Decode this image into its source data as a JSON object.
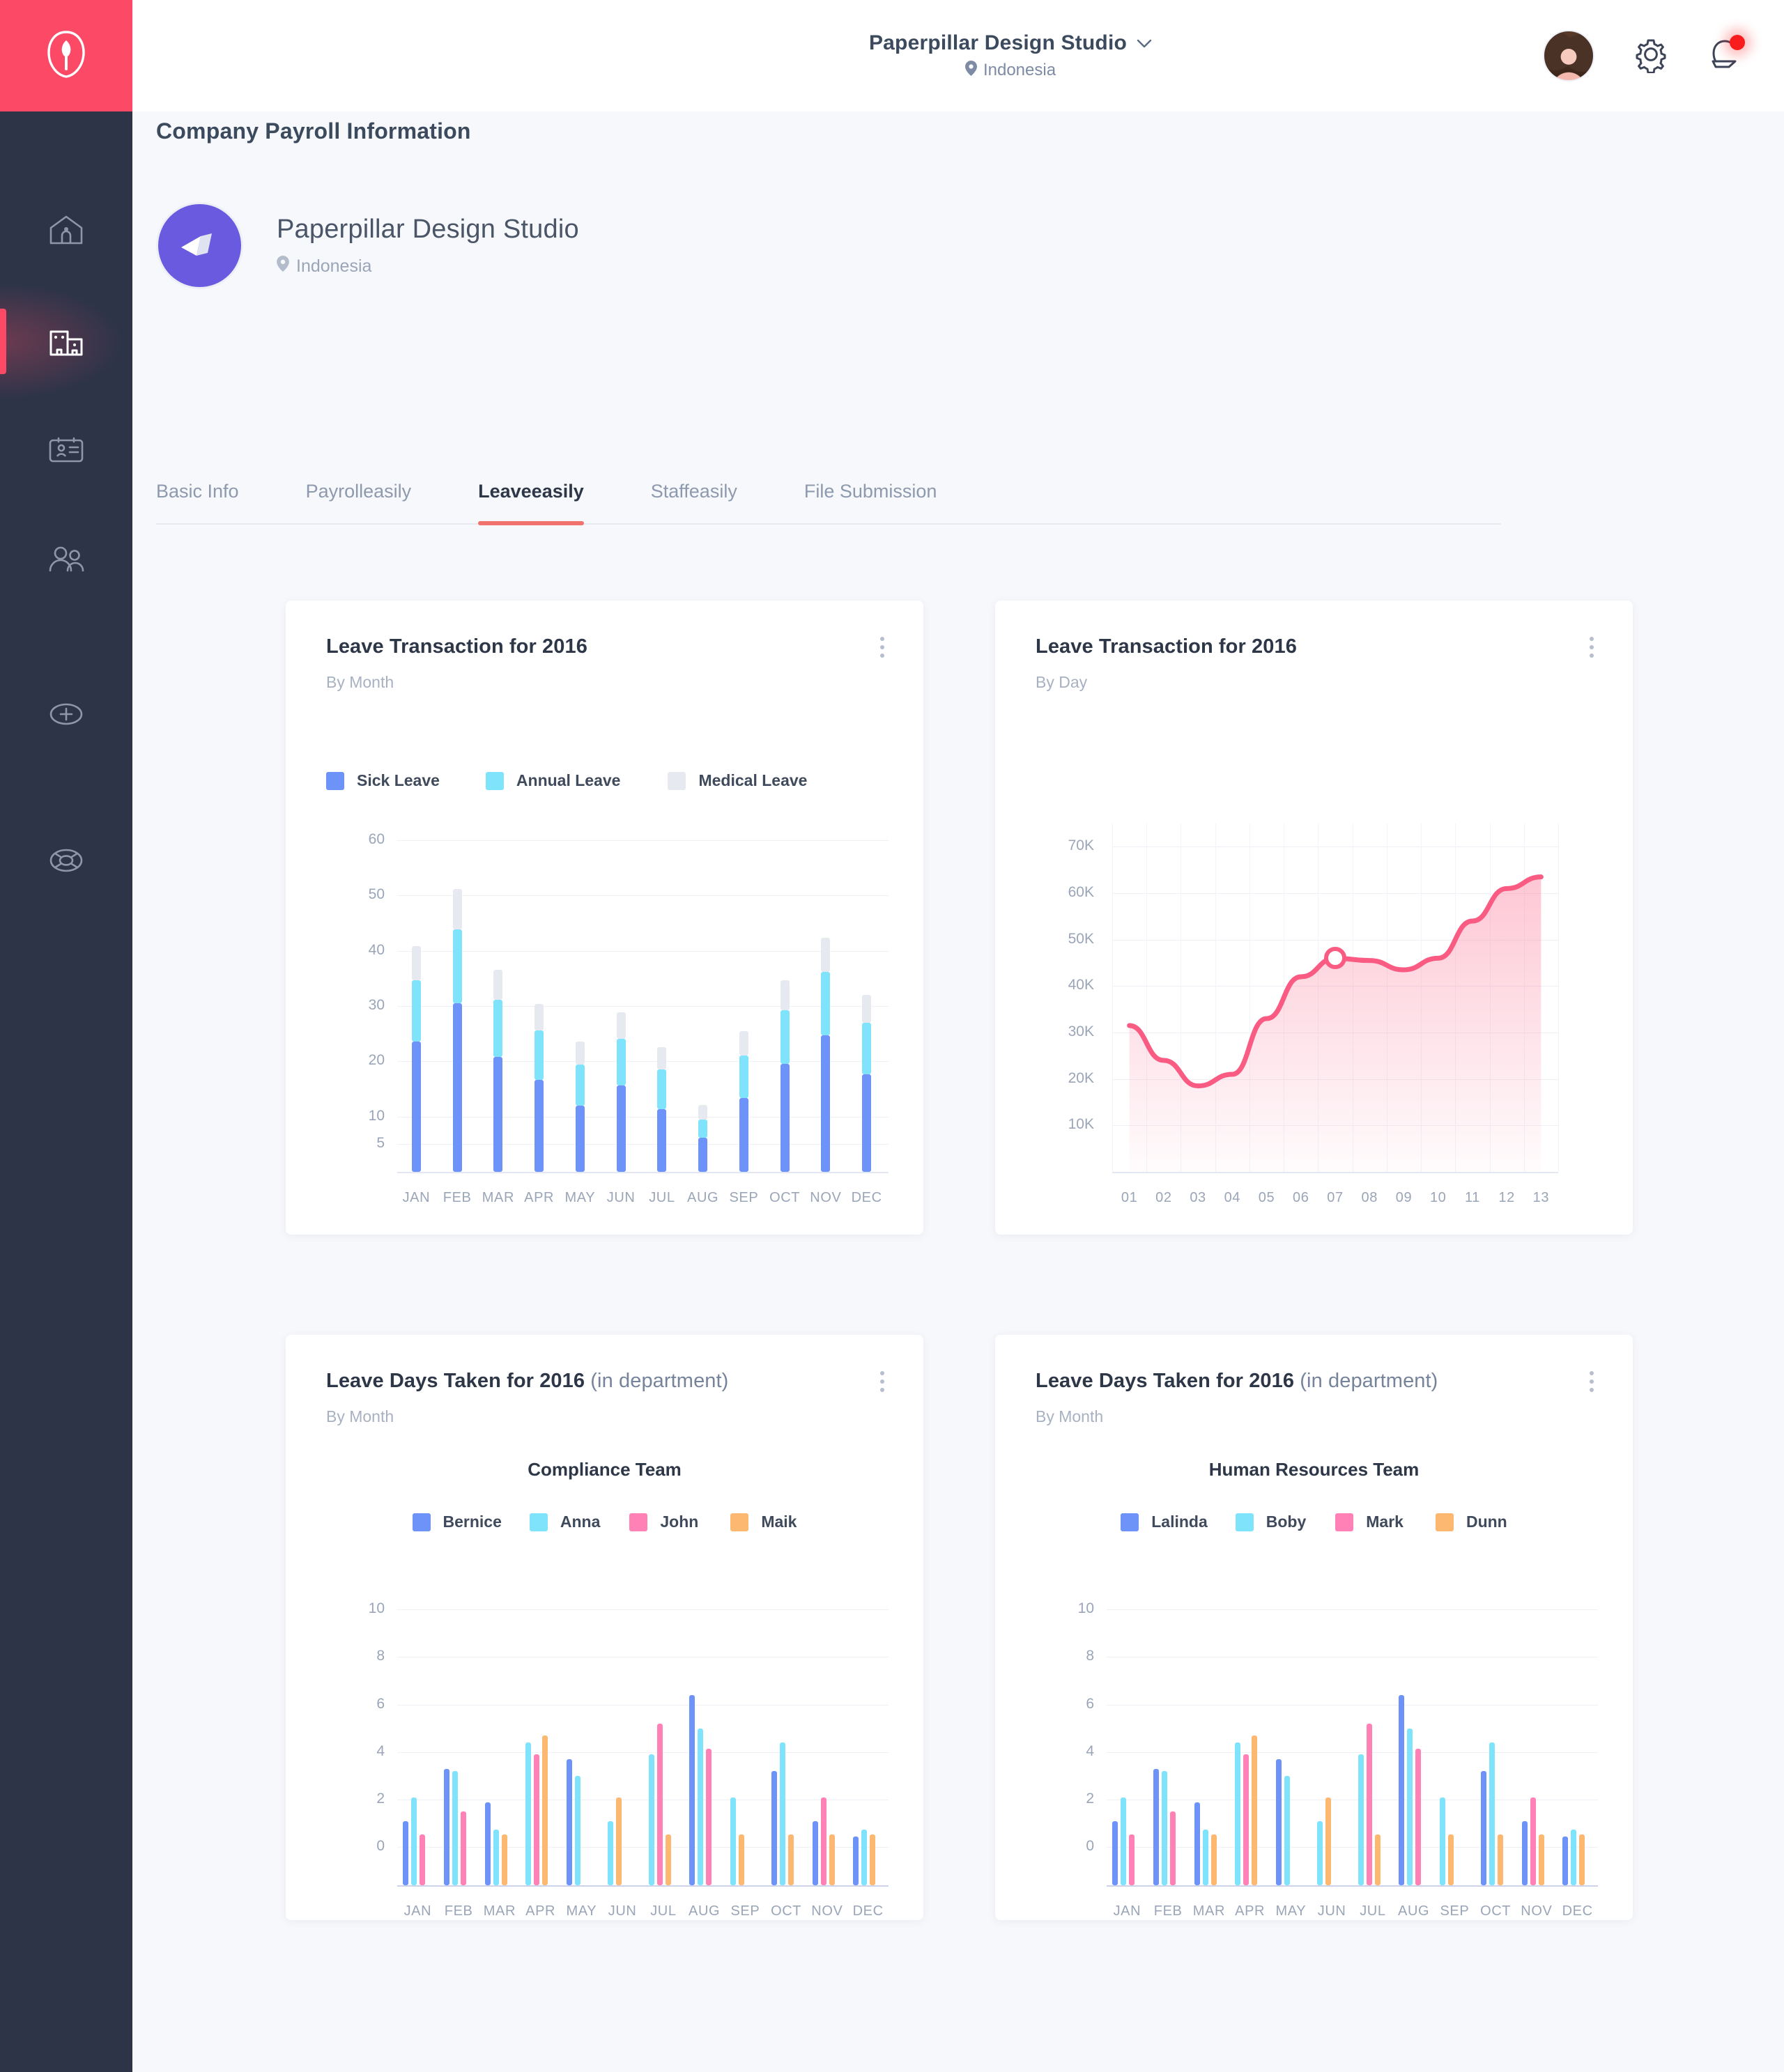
{
  "sidebar": {
    "logo_icon": "leaf-person-logo-icon",
    "items": [
      {
        "icon": "home-icon",
        "name": "home",
        "active": false
      },
      {
        "icon": "buildings-icon",
        "name": "company",
        "active": true
      },
      {
        "icon": "id-card-icon",
        "name": "employee-card",
        "active": false
      },
      {
        "icon": "users-icon",
        "name": "people",
        "active": false
      },
      {
        "icon": "plus-circle-icon",
        "name": "add",
        "active": false
      },
      {
        "icon": "lifebuoy-icon",
        "name": "support",
        "active": false
      }
    ]
  },
  "topbar": {
    "company": "Paperpillar Design Studio",
    "chevron": "˅",
    "location": "Indonesia",
    "avatar_icon": "user-avatar",
    "settings_icon": "gear-icon",
    "notifications_icon": "bell-icon",
    "has_notification": true
  },
  "page": {
    "title": "Company Payroll Information"
  },
  "company": {
    "name": "Paperpillar Design Studio",
    "location": "Indonesia",
    "logo_icon": "paper-plane-logo-icon"
  },
  "tabs": [
    {
      "label": "Basic Info",
      "active": false
    },
    {
      "label": "Payrolleasily",
      "active": false
    },
    {
      "label": "Leaveeasily",
      "active": true
    },
    {
      "label": "Staffeasily",
      "active": false
    },
    {
      "label": "File Submission",
      "active": false
    }
  ],
  "cards": {
    "top_left": {
      "title": "Leave Transaction for 2016",
      "subtitle": "By Month",
      "menu_icon": "kebab-menu-icon"
    },
    "top_right": {
      "title": "Leave Transaction for 2016",
      "subtitle": "By Day",
      "menu_icon": "kebab-menu-icon"
    },
    "bottom_left": {
      "title": "Leave Days Taken for 2016",
      "title_suffix": "(in department)",
      "subtitle": "By Month",
      "team": "Compliance Team",
      "menu_icon": "kebab-menu-icon"
    },
    "bottom_right": {
      "title": "Leave Days Taken for 2016",
      "title_suffix": "(in department)",
      "subtitle": "By Month",
      "team": "Human Resources Team",
      "menu_icon": "kebab-menu-icon"
    }
  },
  "colors": {
    "brand_pink": "#fc4a66",
    "sidebar": "#2e3448",
    "sick_leave": "#6d92f8",
    "annual_leave": "#7fe4fb",
    "medical_leave": "#e6e9f0",
    "series_blue": "#6d92f8",
    "series_cyan": "#7fe4fb",
    "series_pink": "#ff81b5",
    "series_orange": "#fcb濃"
  },
  "chart_data": [
    {
      "id": "leave-transaction-by-month",
      "type": "bar",
      "stacked": true,
      "title": "Leave Transaction for 2016",
      "subtitle": "By Month",
      "xlabel": "",
      "ylabel": "",
      "ylim": [
        0,
        63
      ],
      "yticks": [
        5,
        10,
        20,
        30,
        40,
        50,
        60
      ],
      "grid": true,
      "legend_position": "top-left",
      "categories": [
        "JAN",
        "FEB",
        "MAR",
        "APR",
        "MAY",
        "JUN",
        "JUL",
        "AUG",
        "SEP",
        "OCT",
        "NOV",
        "DEC"
      ],
      "series": [
        {
          "name": "Sick Leave",
          "color": "#6d92f8",
          "values": [
            23.5,
            30.5,
            20.8,
            16.6,
            12.0,
            15.6,
            11.3,
            6.2,
            13.3,
            19.5,
            24.7,
            17.6
          ]
        },
        {
          "name": "Annual Leave",
          "color": "#7fe4fb",
          "values": [
            11.2,
            13.3,
            10.3,
            9.0,
            7.4,
            8.5,
            7.2,
            3.3,
            7.8,
            9.7,
            11.4,
            9.4
          ]
        },
        {
          "name": "Medical Leave",
          "color": "#e6e9f0",
          "values": [
            6.1,
            7.4,
            5.5,
            4.8,
            4.1,
            4.7,
            4.1,
            2.6,
            4.4,
            5.4,
            6.2,
            5.0
          ]
        }
      ]
    },
    {
      "id": "leave-transaction-by-day",
      "type": "area",
      "title": "Leave Transaction for 2016",
      "subtitle": "By Day",
      "xlabel": "",
      "ylabel": "",
      "ylim": [
        0,
        75000
      ],
      "yticks": [
        10000,
        20000,
        30000,
        40000,
        50000,
        60000,
        70000
      ],
      "ytick_labels": [
        "10K",
        "20K",
        "30K",
        "40K",
        "50K",
        "60K",
        "70K"
      ],
      "grid": true,
      "line_color": "#fa5b82",
      "fill_color": "rgba(250,91,130,0.20)",
      "marker_at": "07",
      "marker_value": 46000,
      "categories": [
        "01",
        "02",
        "03",
        "04",
        "05",
        "06",
        "07",
        "08",
        "09",
        "10",
        "11",
        "12",
        "13"
      ],
      "values": [
        31500,
        24000,
        18500,
        21000,
        33000,
        42000,
        46000,
        45500,
        43500,
        46000,
        54000,
        61000,
        63500
      ]
    },
    {
      "id": "leave-days-compliance-team",
      "type": "bar",
      "stacked": false,
      "title": "Leave Days Taken for 2016 (in department)",
      "subtitle": "By Month",
      "team": "Compliance Team",
      "xlabel": "",
      "ylabel": "",
      "ylim": [
        -1.5,
        11
      ],
      "yticks": [
        0,
        2,
        4,
        6,
        8,
        10
      ],
      "grid": true,
      "legend_position": "top-center",
      "categories": [
        "JAN",
        "FEB",
        "MAR",
        "APR",
        "MAY",
        "JUN",
        "JUL",
        "AUG",
        "SEP",
        "OCT",
        "NOV",
        "DEC"
      ],
      "series": [
        {
          "name": "Bernice",
          "color": "#6d92f8",
          "values": [
            1.1,
            3.3,
            1.9,
            0,
            3.7,
            0,
            0,
            6.4,
            0,
            3.2,
            1.1,
            0.45
          ]
        },
        {
          "name": "Anna",
          "color": "#7fe4fb",
          "values": [
            2.1,
            3.2,
            0.75,
            4.4,
            3.0,
            1.1,
            3.9,
            5.0,
            2.1,
            4.4,
            0,
            0.75
          ]
        },
        {
          "name": "John",
          "color": "#ff81b5",
          "values": [
            0.55,
            1.5,
            0,
            3.9,
            0,
            0,
            5.2,
            4.15,
            0,
            0,
            2.1,
            0
          ]
        },
        {
          "name": "Maik",
          "color": "#fcb871",
          "values": [
            0,
            0,
            0.55,
            4.7,
            0,
            2.1,
            0.55,
            0,
            0.55,
            0.55,
            0.55,
            0.55
          ]
        }
      ]
    },
    {
      "id": "leave-days-human-resources-team",
      "type": "bar",
      "stacked": false,
      "title": "Leave Days Taken for 2016 (in department)",
      "subtitle": "By Month",
      "team": "Human Resources Team",
      "xlabel": "",
      "ylabel": "",
      "ylim": [
        -1.5,
        11
      ],
      "yticks": [
        0,
        2,
        4,
        6,
        8,
        10
      ],
      "grid": true,
      "legend_position": "top-center",
      "categories": [
        "JAN",
        "FEB",
        "MAR",
        "APR",
        "MAY",
        "JUN",
        "JUL",
        "AUG",
        "SEP",
        "OCT",
        "NOV",
        "DEC"
      ],
      "series": [
        {
          "name": "Lalinda",
          "color": "#6d92f8",
          "values": [
            1.1,
            3.3,
            1.9,
            0,
            3.7,
            0,
            0,
            6.4,
            0,
            3.2,
            1.1,
            0.45
          ]
        },
        {
          "name": "Boby",
          "color": "#7fe4fb",
          "values": [
            2.1,
            3.2,
            0.75,
            4.4,
            3.0,
            1.1,
            3.9,
            5.0,
            2.1,
            4.4,
            0,
            0.75
          ]
        },
        {
          "name": "Mark",
          "color": "#ff81b5",
          "values": [
            0.55,
            1.5,
            0,
            3.9,
            0,
            0,
            5.2,
            4.15,
            0,
            0,
            2.1,
            0
          ]
        },
        {
          "name": "Dunn",
          "color": "#fcb871",
          "values": [
            0,
            0,
            0.55,
            4.7,
            0,
            2.1,
            0.55,
            0,
            0.55,
            0.55,
            0.55,
            0.55
          ]
        }
      ]
    }
  ]
}
